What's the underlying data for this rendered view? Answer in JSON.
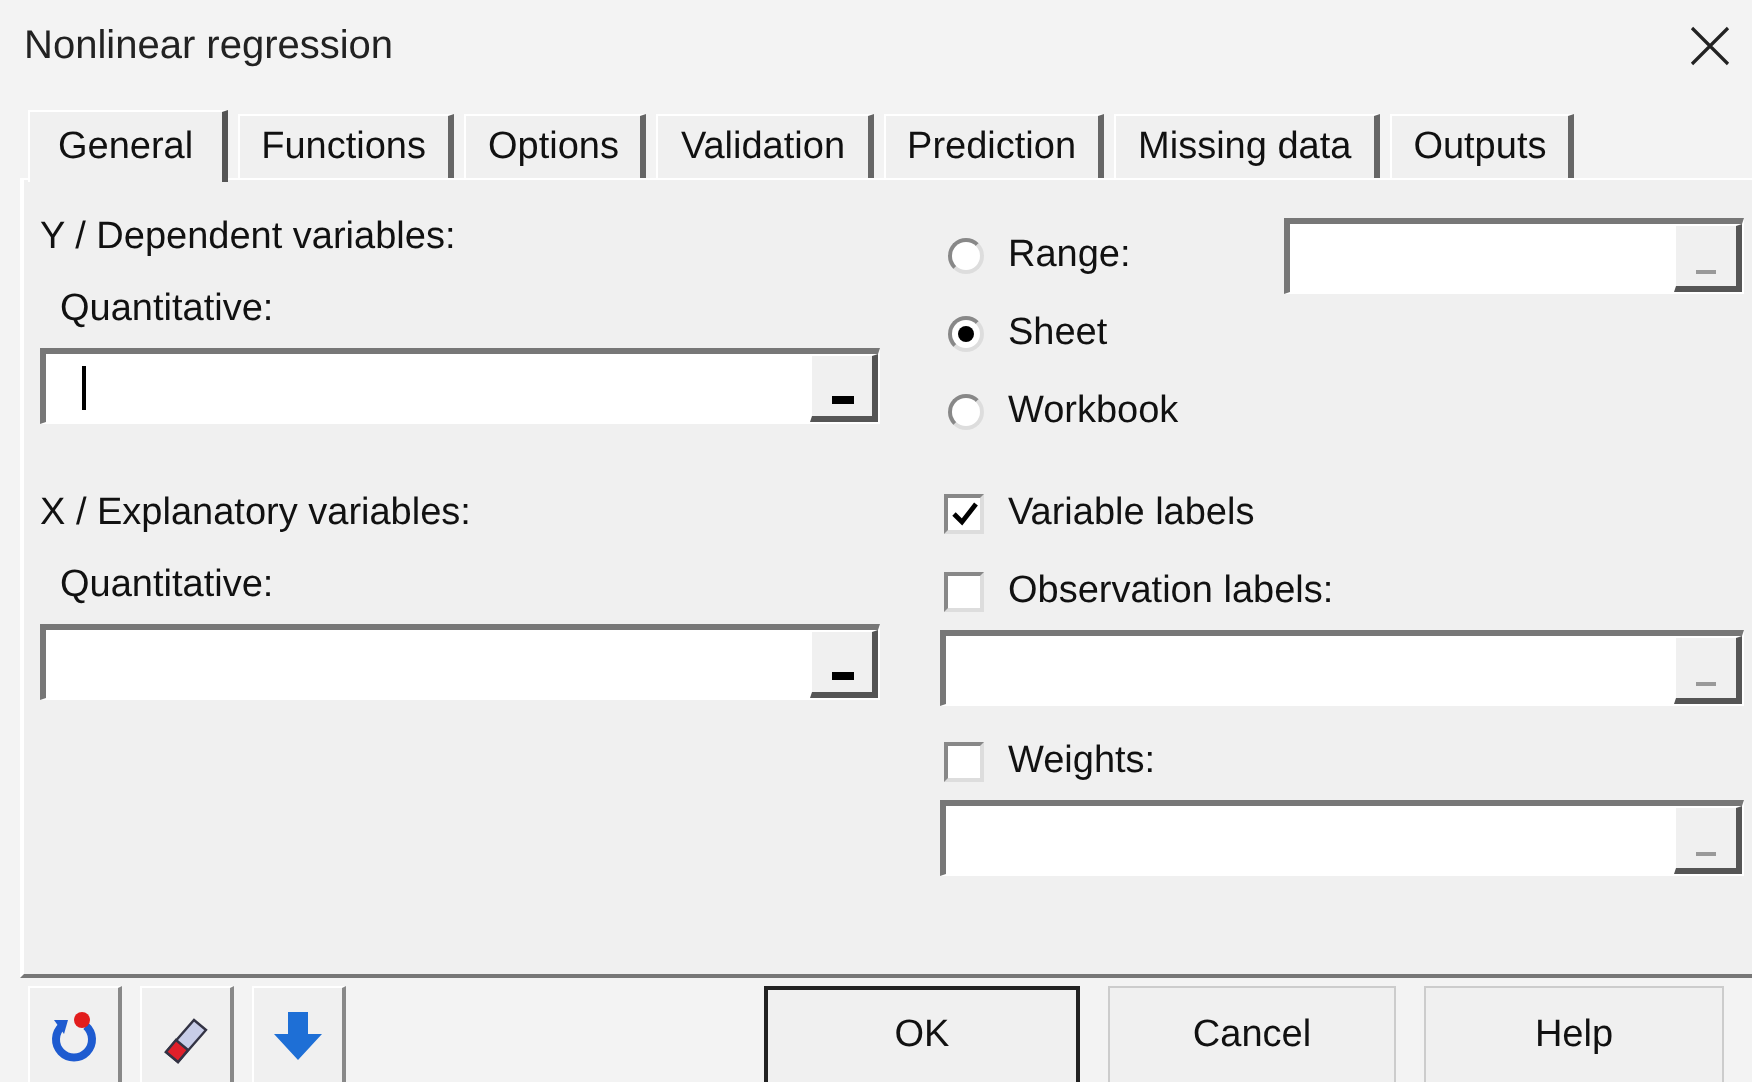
{
  "window": {
    "title": "Nonlinear regression"
  },
  "tabs": [
    {
      "label": "General",
      "selected": true
    },
    {
      "label": "Functions",
      "selected": false
    },
    {
      "label": "Options",
      "selected": false
    },
    {
      "label": "Validation",
      "selected": false
    },
    {
      "label": "Prediction",
      "selected": false
    },
    {
      "label": "Missing data",
      "selected": false
    },
    {
      "label": "Outputs",
      "selected": false
    }
  ],
  "dependent": {
    "heading": "Y / Dependent variables:",
    "label": "Quantitative:",
    "field": {
      "focused": true,
      "disabled": false
    }
  },
  "explanatory": {
    "heading": "X / Explanatory variables:",
    "label": "Quantitative:",
    "field": {
      "focused": false,
      "disabled": false
    }
  },
  "range_options": [
    {
      "label": "Range:",
      "selected": false
    },
    {
      "label": "Sheet",
      "selected": true
    },
    {
      "label": "Workbook",
      "selected": false
    }
  ],
  "range_field": {
    "focused": false,
    "disabled": true
  },
  "options": [
    {
      "label": "Variable labels",
      "checked": true
    },
    {
      "label": "Observation labels:",
      "checked": false,
      "field": {
        "focused": false,
        "disabled": true
      }
    },
    {
      "label": "Weights:",
      "checked": false,
      "field": {
        "focused": false,
        "disabled": true
      }
    }
  ],
  "toolbar": [
    {
      "kind": "reset"
    },
    {
      "kind": "erase"
    },
    {
      "kind": "down"
    }
  ],
  "buttons": [
    {
      "label": "OK",
      "default": true
    },
    {
      "label": "Cancel",
      "default": false
    },
    {
      "label": "Help",
      "default": false
    }
  ]
}
